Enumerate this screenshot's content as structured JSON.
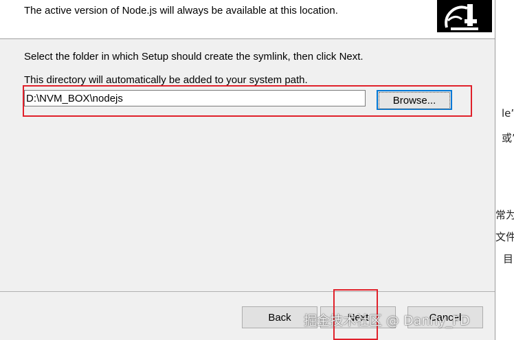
{
  "header": {
    "description": "The active version of Node.js will always be available at this location."
  },
  "main": {
    "instruction": "Select the folder in which Setup should create the symlink, then click Next.",
    "note": "This directory will automatically be added to your system path.",
    "path_value": "D:\\NVM_BOX\\nodejs",
    "browse_label": "Browse..."
  },
  "footer": {
    "back_label": "Back",
    "next_label": "Next",
    "cancel_label": "Cancel"
  },
  "background_text": {
    "line1": "le”,",
    "line2": "或”。",
    "line3": "常为",
    "line4": "文件",
    "line5": "目"
  },
  "watermark": "掘金技术社区 @ Danny_FD",
  "colors": {
    "highlight": "#e0202a",
    "focus": "#0078d7",
    "dialog_bg": "#f0f0f0"
  },
  "icons": {
    "logo": "nvm-logo-icon"
  }
}
